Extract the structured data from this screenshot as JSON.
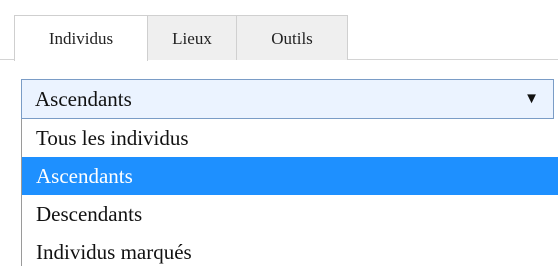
{
  "tabs": [
    {
      "label": "Individus",
      "active": true
    },
    {
      "label": "Lieux",
      "active": false
    },
    {
      "label": "Outils",
      "active": false
    }
  ],
  "select": {
    "value": "Ascendants",
    "arrow_icon": "dropdown-arrow-icon"
  },
  "options": [
    {
      "label": "Tous les individus"
    },
    {
      "label": "Ascendants",
      "selected": true
    },
    {
      "label": "Descendants"
    },
    {
      "label": "Individus marqués"
    }
  ],
  "colors": {
    "selected_option_bg": "#1e90ff",
    "select_bg": "#ebf3ff",
    "select_border": "#7a9cc6"
  }
}
